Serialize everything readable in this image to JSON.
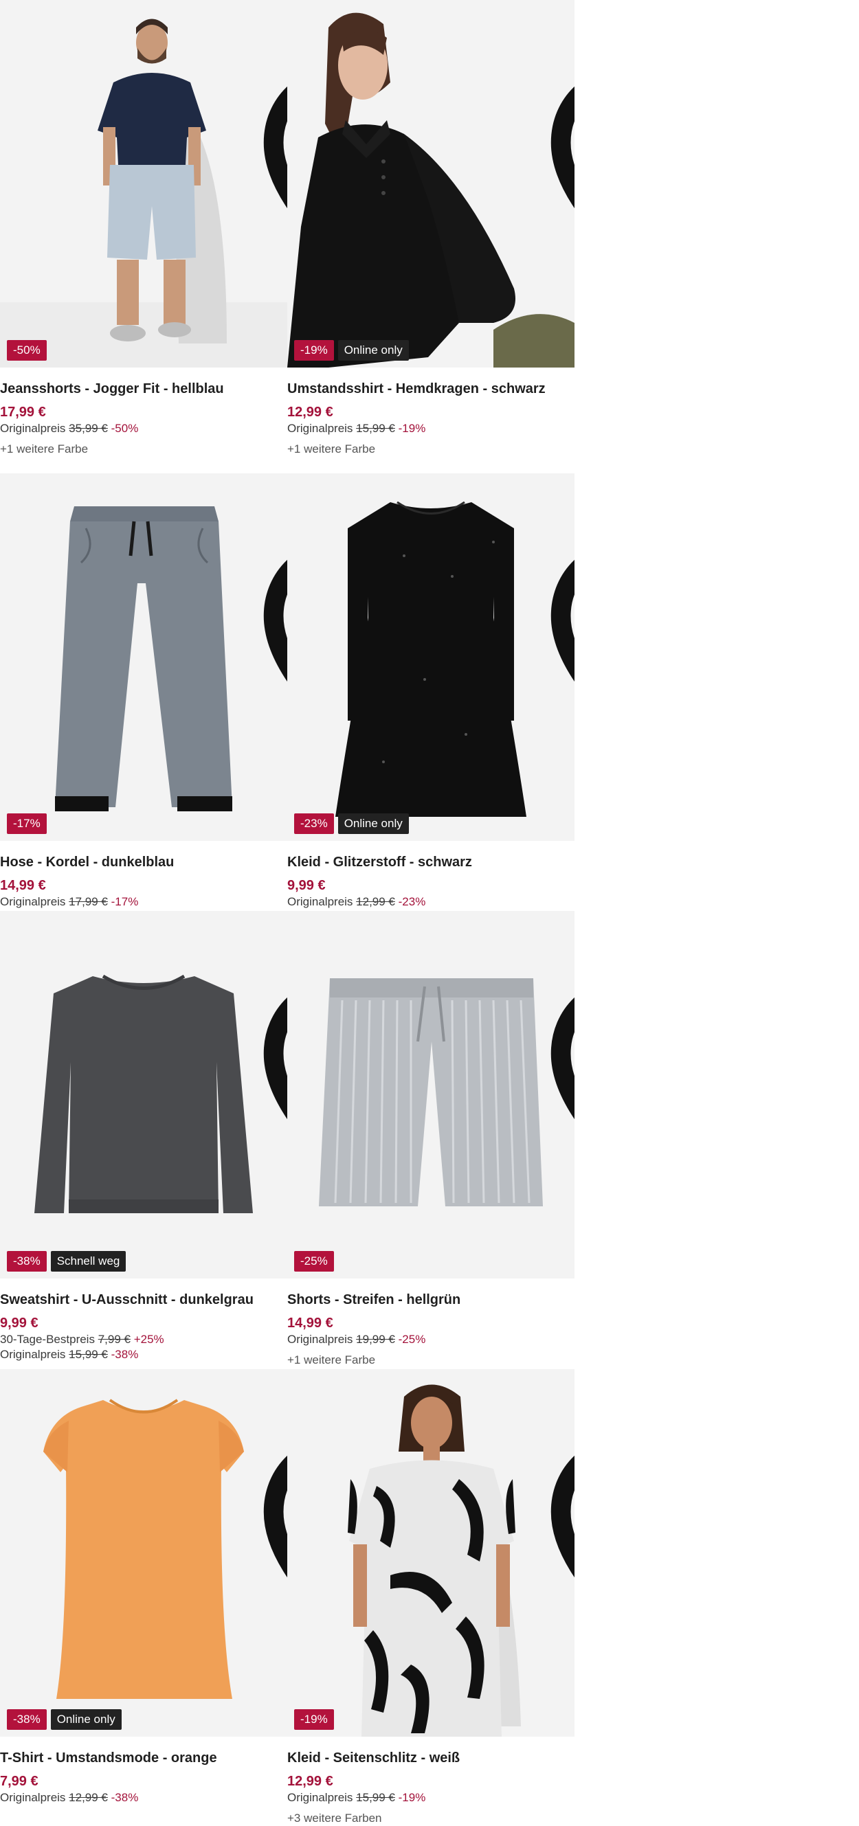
{
  "products": [
    {
      "name": "Jeansshorts - Jogger Fit - hellblau",
      "price": "17,99 €",
      "lines": [
        {
          "label": "Originalpreis",
          "old": "35,99 €",
          "pct": "-50%"
        }
      ],
      "colors": "+1 weitere Farbe",
      "badge": "-50%",
      "tag": "",
      "image": "man-polo-denim-shorts"
    },
    {
      "name": "Umstandsshirt - Hemdkragen - schwarz",
      "price": "12,99 €",
      "lines": [
        {
          "label": "Originalpreis",
          "old": "15,99 €",
          "pct": "-19%"
        }
      ],
      "colors": "+1 weitere Farbe",
      "badge": "-19%",
      "tag": "Online only",
      "image": "woman-black-shirt"
    },
    {
      "name": "Hose - Kordel - dunkelblau",
      "price": "14,99 €",
      "lines": [
        {
          "label": "Originalpreis",
          "old": "17,99 €",
          "pct": "-17%"
        }
      ],
      "colors": "",
      "badge": "-17%",
      "tag": "",
      "image": "grey-trousers"
    },
    {
      "name": "Kleid - Glitzerstoff - schwarz",
      "price": "9,99 €",
      "lines": [
        {
          "label": "Originalpreis",
          "old": "12,99 €",
          "pct": "-23%"
        }
      ],
      "colors": "",
      "badge": "-23%",
      "tag": "Online only",
      "image": "black-velvet-dress"
    },
    {
      "name": "Sweatshirt - U-Ausschnitt - dunkelgrau",
      "price": "9,99 €",
      "lines": [
        {
          "label": "30-Tage-Bestpreis",
          "old": "7,99 €",
          "pct": "+25%"
        },
        {
          "label": "Originalpreis",
          "old": "15,99 €",
          "pct": "-38%"
        }
      ],
      "colors": "",
      "badge": "-38%",
      "tag": "Schnell weg",
      "image": "grey-sweatshirt"
    },
    {
      "name": "Shorts - Streifen - hellgrün",
      "price": "14,99 €",
      "lines": [
        {
          "label": "Originalpreis",
          "old": "19,99 €",
          "pct": "-25%"
        }
      ],
      "colors": "+1 weitere Farbe",
      "badge": "-25%",
      "tag": "",
      "image": "striped-shorts"
    },
    {
      "name": "T-Shirt - Umstandsmode - orange",
      "price": "7,99 €",
      "lines": [
        {
          "label": "Originalpreis",
          "old": "12,99 €",
          "pct": "-38%"
        }
      ],
      "colors": "",
      "badge": "-38%",
      "tag": "Online only",
      "image": "orange-tshirt"
    },
    {
      "name": "Kleid - Seitenschlitz - weiß",
      "price": "12,99 €",
      "lines": [
        {
          "label": "Originalpreis",
          "old": "15,99 €",
          "pct": "-19%"
        }
      ],
      "colors": "+3 weitere Farben",
      "badge": "-19%",
      "tag": "",
      "image": "woman-print-dress"
    }
  ],
  "theme": {
    "accent": "#a3123a",
    "badge": "#b3123c",
    "tag": "#222222",
    "imageBg": "#f2f2f2"
  },
  "icons": {
    "favorite": "heart-outline-icon"
  }
}
